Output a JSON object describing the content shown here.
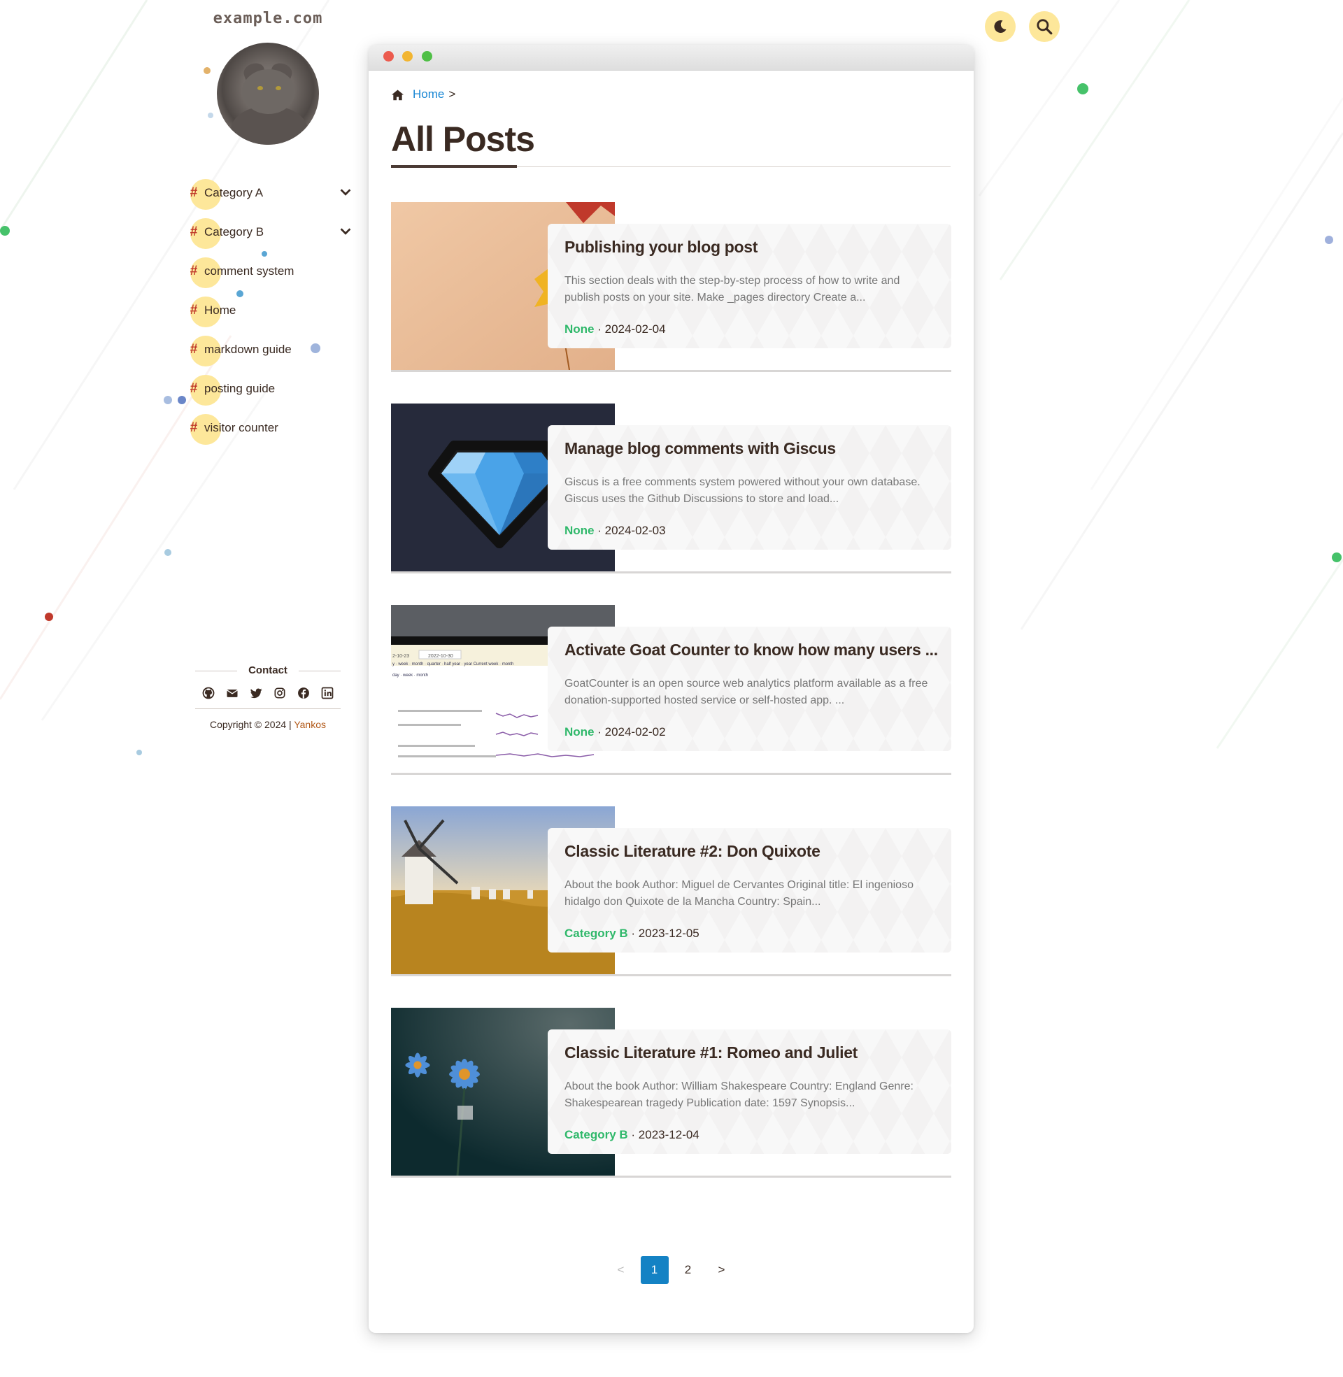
{
  "site": {
    "title": "example.com"
  },
  "sidebar": {
    "categories": [
      {
        "label": "Category A",
        "expandable": true
      },
      {
        "label": "Category B",
        "expandable": true
      },
      {
        "label": "comment system",
        "expandable": false
      },
      {
        "label": "Home",
        "expandable": false
      },
      {
        "label": "markdown guide",
        "expandable": false
      },
      {
        "label": "posting guide",
        "expandable": false
      },
      {
        "label": "visitor counter",
        "expandable": false
      }
    ],
    "hash_symbol": "#",
    "contact": {
      "title": "Contact",
      "icons": [
        "github-icon",
        "email-icon",
        "twitter-icon",
        "instagram-icon",
        "facebook-icon",
        "linkedin-icon"
      ]
    },
    "copyright": {
      "prefix": "Copyright © 2024 | ",
      "author": "Yankos"
    }
  },
  "toolbar": {
    "dark_mode_icon": "moon-icon",
    "search_icon": "search-icon"
  },
  "breadcrumb": {
    "home": "Home",
    "separator": ">"
  },
  "main": {
    "title": "All Posts",
    "posts": [
      {
        "title": "Publishing your blog post",
        "excerpt": "This section deals with the step-by-step process of how to write and publish posts on your site. Make _pages directory Create a...",
        "category": "None",
        "date": "· 2024-02-04"
      },
      {
        "title": "Manage blog comments with Giscus",
        "excerpt": "Giscus is a free comments system powered without your own database. Giscus uses the Github Discussions to store and load...",
        "category": "None",
        "date": "· 2024-02-03"
      },
      {
        "title": "Activate Goat Counter to know how many users ...",
        "excerpt": "GoatCounter is an open source web analytics platform available as a free donation-supported hosted service or self-hosted app. ...",
        "category": "None",
        "date": "· 2024-02-02"
      },
      {
        "title": "Classic Literature #2: Don Quixote",
        "excerpt": "About the book Author: Miguel de Cervantes Original title: El ingenioso hidalgo don Quixote de la Mancha Country: Spain...",
        "category": "Category B",
        "date": "· 2023-12-05"
      },
      {
        "title": "Classic Literature #1: Romeo and Juliet",
        "excerpt": "About the book Author: William Shakespeare Country: England Genre: Shakespearean tragedy Publication date: 1597 Synopsis...",
        "category": "Category B",
        "date": "· 2023-12-04"
      }
    ],
    "thumbnail_texts": {
      "goat_dates": [
        "2-10-23",
        "2022-10-30"
      ],
      "goat_range": "y · week · month · quarter · half year · year   Current week · month",
      "goat_period": "day · week · month"
    }
  },
  "pagination": {
    "prev": "<",
    "pages": [
      "1",
      "2"
    ],
    "current": "1",
    "next": ">"
  },
  "colors": {
    "accent_yellow": "#fde79a",
    "link_blue": "#1a87d4",
    "category_green": "#2fb86a",
    "hash_red": "#c0392b",
    "page_active": "#1482c4"
  }
}
